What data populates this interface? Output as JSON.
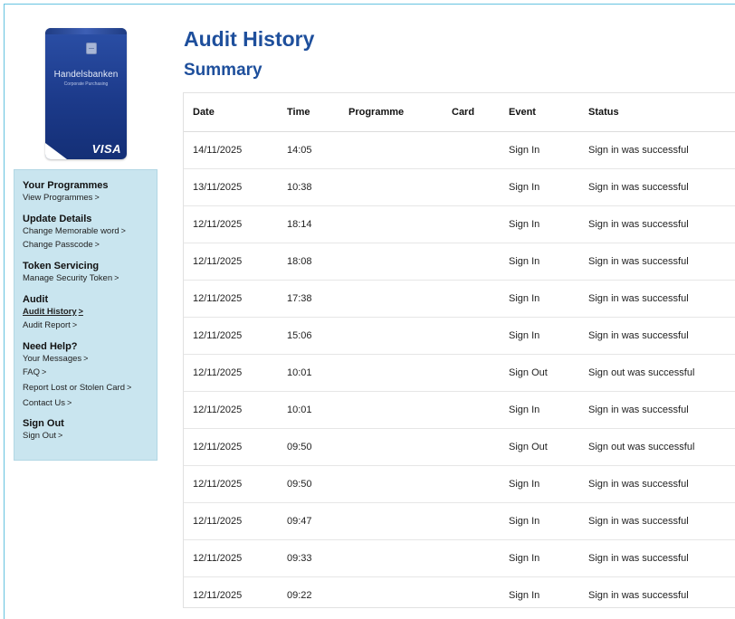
{
  "card": {
    "brand": "Handelsbanken",
    "subtitle": "Corporate Purchasing",
    "network": "VISA"
  },
  "sidebar": {
    "sections": [
      {
        "heading": "Your Programmes",
        "links": [
          {
            "label": "View Programmes"
          }
        ]
      },
      {
        "heading": "Update Details",
        "links": [
          {
            "label": "Change Memorable word"
          },
          {
            "label": "Change Passcode"
          }
        ]
      },
      {
        "heading": "Token Servicing",
        "links": [
          {
            "label": "Manage Security Token"
          }
        ]
      },
      {
        "heading": "Audit",
        "links": [
          {
            "label": "Audit History",
            "active": true
          },
          {
            "label": "Audit Report"
          }
        ]
      },
      {
        "heading": "Need Help?",
        "links": [
          {
            "label": "Your Messages"
          },
          {
            "label": "FAQ"
          },
          {
            "label": "Report Lost or Stolen Card"
          },
          {
            "label": "Contact Us"
          }
        ]
      },
      {
        "heading": "Sign Out",
        "links": [
          {
            "label": "Sign Out"
          }
        ]
      }
    ],
    "chevron": ">"
  },
  "main": {
    "title": "Audit History",
    "subtitle": "Summary"
  },
  "table": {
    "columns": {
      "date": "Date",
      "time": "Time",
      "programme": "Programme",
      "card": "Card",
      "event": "Event",
      "status": "Status"
    },
    "rows": [
      {
        "date": "14/11/2025",
        "time": "14:05",
        "programme": "",
        "card": "",
        "event": "Sign In",
        "status": "Sign in was successful"
      },
      {
        "date": "13/11/2025",
        "time": "10:38",
        "programme": "",
        "card": "",
        "event": "Sign In",
        "status": "Sign in was successful"
      },
      {
        "date": "12/11/2025",
        "time": "18:14",
        "programme": "",
        "card": "",
        "event": "Sign In",
        "status": "Sign in was successful"
      },
      {
        "date": "12/11/2025",
        "time": "18:08",
        "programme": "",
        "card": "",
        "event": "Sign In",
        "status": "Sign in was successful"
      },
      {
        "date": "12/11/2025",
        "time": "17:38",
        "programme": "",
        "card": "",
        "event": "Sign In",
        "status": "Sign in was successful"
      },
      {
        "date": "12/11/2025",
        "time": "15:06",
        "programme": "",
        "card": "",
        "event": "Sign In",
        "status": "Sign in was successful"
      },
      {
        "date": "12/11/2025",
        "time": "10:01",
        "programme": "",
        "card": "",
        "event": "Sign Out",
        "status": "Sign out was successful"
      },
      {
        "date": "12/11/2025",
        "time": "10:01",
        "programme": "",
        "card": "",
        "event": "Sign In",
        "status": "Sign in was successful"
      },
      {
        "date": "12/11/2025",
        "time": "09:50",
        "programme": "",
        "card": "",
        "event": "Sign Out",
        "status": "Sign out was successful"
      },
      {
        "date": "12/11/2025",
        "time": "09:50",
        "programme": "",
        "card": "",
        "event": "Sign In",
        "status": "Sign in was successful"
      },
      {
        "date": "12/11/2025",
        "time": "09:47",
        "programme": "",
        "card": "",
        "event": "Sign In",
        "status": "Sign in was successful"
      },
      {
        "date": "12/11/2025",
        "time": "09:33",
        "programme": "",
        "card": "",
        "event": "Sign In",
        "status": "Sign in was successful"
      },
      {
        "date": "12/11/2025",
        "time": "09:22",
        "programme": "",
        "card": "",
        "event": "Sign In",
        "status": "Sign in was successful"
      }
    ]
  },
  "colors": {
    "title": "#1e4f9c",
    "sidebar_bg": "#c9e5ef",
    "card_bg": "#1c3a8a",
    "frame_border": "#66c3e0"
  }
}
